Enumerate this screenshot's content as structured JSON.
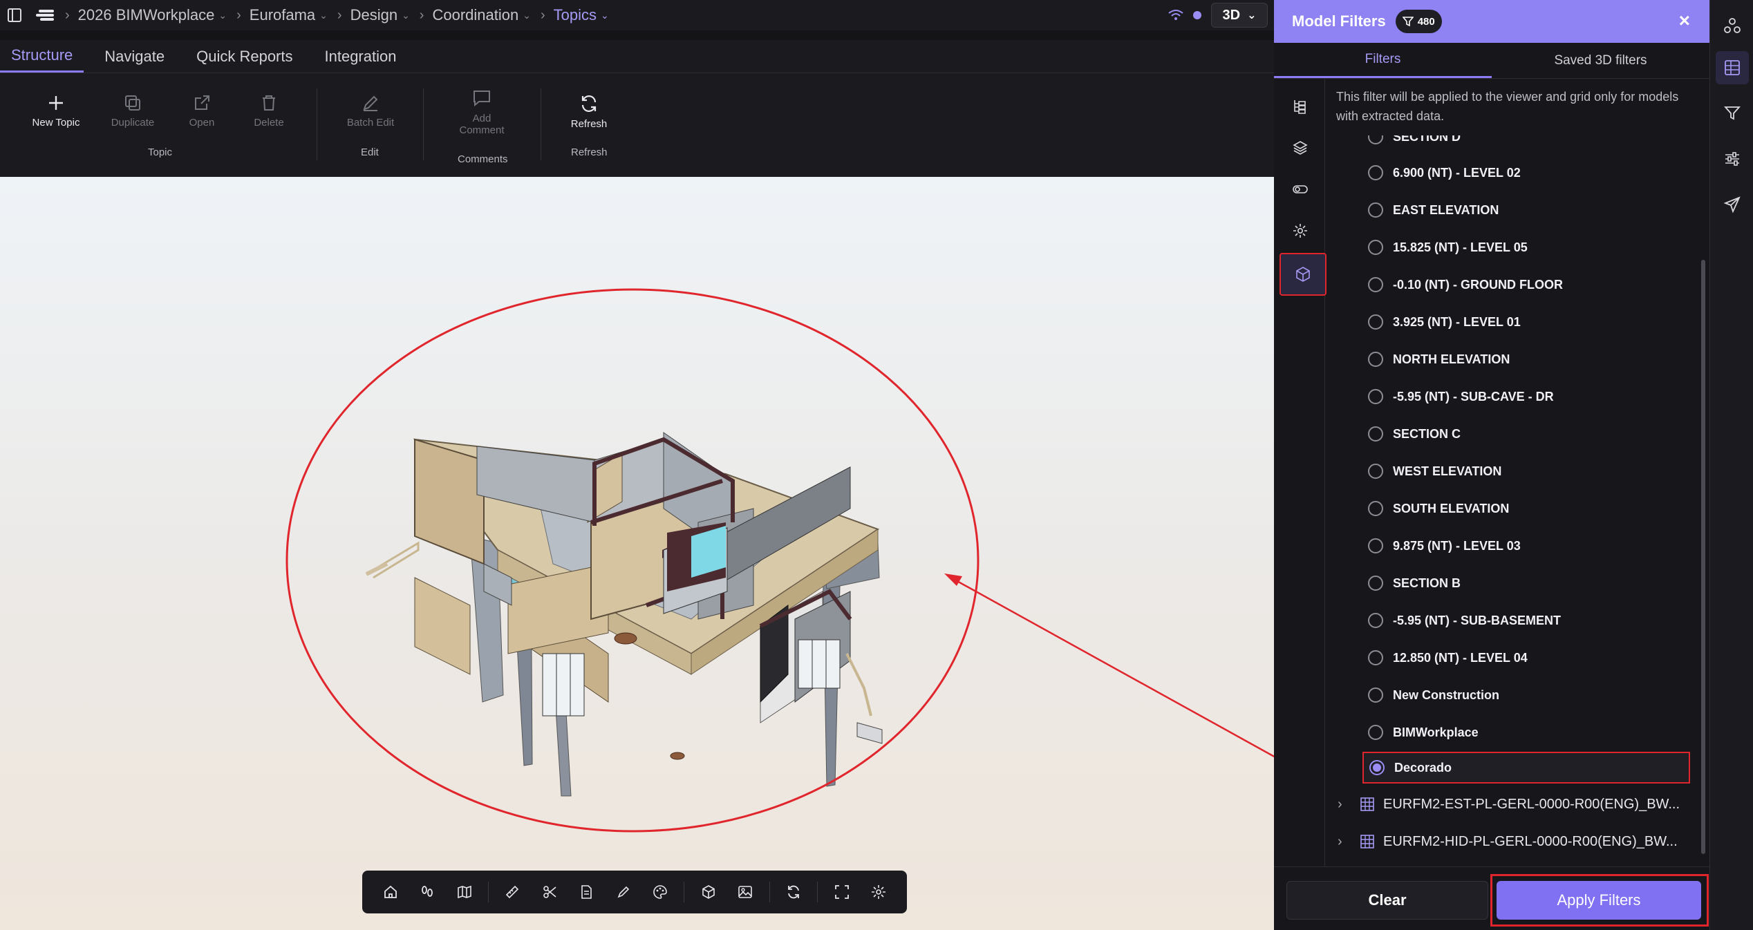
{
  "breadcrumb": {
    "items": [
      "2026 BIMWorkplace",
      "Eurofama",
      "Design",
      "Coordination",
      "Topics"
    ]
  },
  "view_mode": "3D",
  "tabs": [
    "Structure",
    "Navigate",
    "Quick Reports",
    "Integration"
  ],
  "ribbon": {
    "new_topic": "New Topic",
    "duplicate": "Duplicate",
    "open": "Open",
    "delete": "Delete",
    "topic_group": "Topic",
    "batch_edit": "Batch Edit",
    "edit_group": "Edit",
    "add_comment_1": "Add",
    "add_comment_2": "Comment",
    "comments_group": "Comments",
    "refresh": "Refresh",
    "refresh_group": "Refresh"
  },
  "panel": {
    "title": "Model Filters",
    "count": "480",
    "tab_filters": "Filters",
    "tab_saved": "Saved 3D filters",
    "note": "This filter will be applied to the viewer and grid only for models with extracted data.",
    "items": [
      {
        "label": "SECTION D"
      },
      {
        "label": "6.900 (NT) - LEVEL 02"
      },
      {
        "label": "EAST ELEVATION"
      },
      {
        "label": "15.825 (NT) - LEVEL 05"
      },
      {
        "label": "-0.10 (NT) - GROUND FLOOR"
      },
      {
        "label": "3.925 (NT) - LEVEL 01"
      },
      {
        "label": "NORTH ELEVATION"
      },
      {
        "label": "-5.95 (NT) - SUB-CAVE - DR"
      },
      {
        "label": "SECTION C"
      },
      {
        "label": "WEST ELEVATION"
      },
      {
        "label": "SOUTH ELEVATION"
      },
      {
        "label": "9.875 (NT) - LEVEL 03"
      },
      {
        "label": "SECTION B"
      },
      {
        "label": "-5.95 (NT) - SUB-BASEMENT"
      },
      {
        "label": "12.850 (NT) - LEVEL 04"
      },
      {
        "label": "New Construction"
      },
      {
        "label": "BIMWorkplace"
      },
      {
        "label": "Decorado",
        "selected": true
      }
    ],
    "models": [
      "EURFM2-EST-PL-GERL-0000-R00(ENG)_BW...",
      "EURFM2-HID-PL-GERL-0000-R00(ENG)_BW..."
    ],
    "clear_label": "Clear",
    "apply_label": "Apply Filters"
  },
  "colors": {
    "accent": "#8f82f2",
    "annotation": "#e0262c"
  }
}
